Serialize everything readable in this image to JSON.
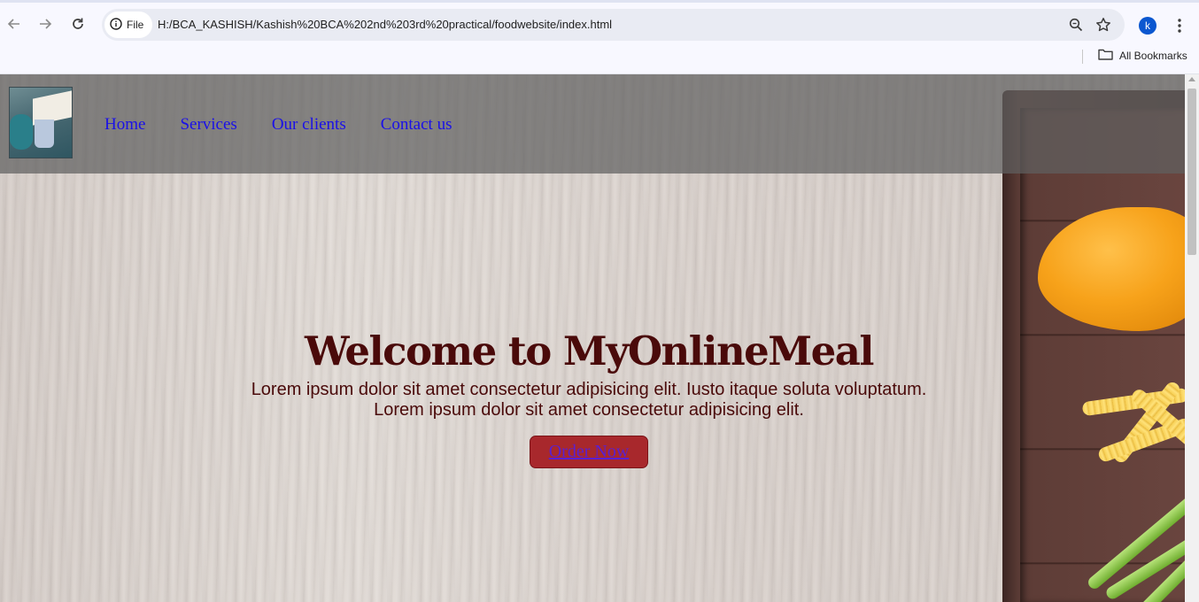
{
  "browser": {
    "site_chip_label": "File",
    "url": "H:/BCA_KASHISH/Kashish%20BCA%202nd%203rd%20practical/foodwebsite/index.html",
    "avatar_letter": "k",
    "bookmarks_label": "All Bookmarks",
    "icons": [
      "back-icon",
      "forward-icon",
      "reload-icon",
      "info-icon",
      "zoom-icon",
      "star-icon",
      "kebab-menu-icon",
      "folder-icon"
    ]
  },
  "site": {
    "nav": {
      "home": "Home",
      "services": "Services",
      "clients": "Our clients",
      "contact": "Contact us"
    },
    "hero": {
      "title": "Welcome to MyOnlineMeal",
      "line1": "Lorem ipsum dolor sit amet consectetur adipisicing elit. Iusto itaque soluta voluptatum.",
      "line2": "Lorem ipsum dolor sit amet consectetur adipisicing elit.",
      "button": "Order Now"
    },
    "colors": {
      "title": "#4a0a0a",
      "nav_link": "#1a10e8",
      "button_bg": "#a8282c"
    }
  }
}
